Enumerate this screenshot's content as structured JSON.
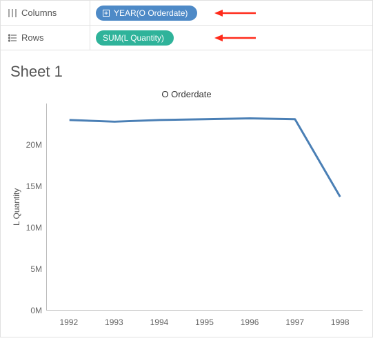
{
  "shelves": {
    "columns": {
      "label": "Columns",
      "pill": "YEAR(O Orderdate)"
    },
    "rows": {
      "label": "Rows",
      "pill": "SUM(L Quantity)"
    }
  },
  "sheet": {
    "title": "Sheet 1",
    "chart_title": "O Orderdate",
    "y_axis_title": "L Quantity"
  },
  "chart_data": {
    "type": "line",
    "categories": [
      "1992",
      "1993",
      "1994",
      "1995",
      "1996",
      "1997",
      "1998"
    ],
    "values": [
      23.0,
      22.8,
      23.0,
      23.1,
      23.2,
      23.1,
      13.7
    ],
    "xlabel": "O Orderdate",
    "ylabel": "L Quantity",
    "ylim": [
      0,
      25
    ],
    "y_ticks": [
      "20M",
      "15M",
      "10M",
      "5M",
      "0M"
    ]
  }
}
